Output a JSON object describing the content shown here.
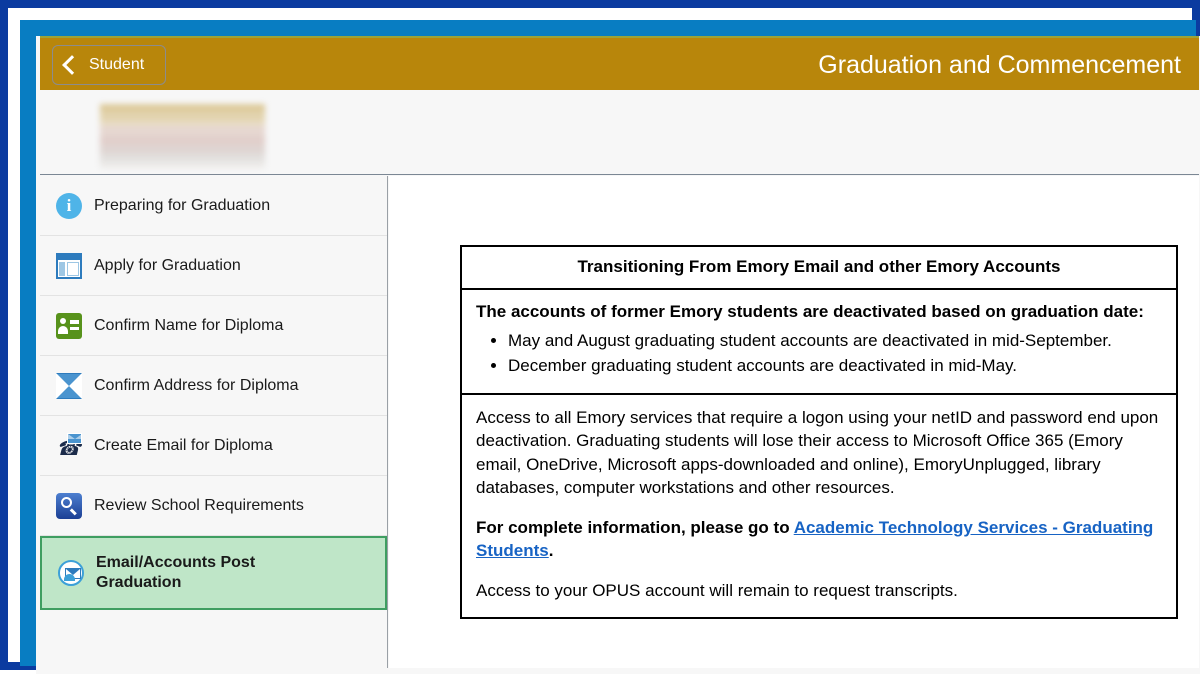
{
  "window": {
    "outer_border_color": "#0b3ba0",
    "inner_border_color": "#087dc2"
  },
  "header": {
    "title": "Graduation and Commencement",
    "back_label": "Student",
    "back_icon": "chevron-left-icon",
    "background_color": "#b8860b"
  },
  "identity": {
    "redacted": true
  },
  "sidebar": {
    "selected_background_color": "#bfe6c8",
    "selected_border_color": "#3f9e61",
    "items": [
      {
        "label": "Preparing for Graduation",
        "icon": "info-circle-icon",
        "selected": false
      },
      {
        "label": "Apply for Graduation",
        "icon": "window-form-icon",
        "selected": false
      },
      {
        "label": "Confirm Name for Diploma",
        "icon": "id-card-icon",
        "selected": false
      },
      {
        "label": "Confirm Address for Diploma",
        "icon": "envelope-icon",
        "selected": false
      },
      {
        "label": "Create Email for Diploma",
        "icon": "phone-mail-icon",
        "selected": false
      },
      {
        "label": "Review School Requirements",
        "icon": "search-icon",
        "selected": false
      },
      {
        "label": "Email/Accounts Post Graduation",
        "icon": "mail-users-icon",
        "selected": true
      }
    ]
  },
  "content": {
    "table_title": "Transitioning From Emory Email and other Emory Accounts",
    "intro_heading": "The accounts of former Emory students are deactivated based on graduation date:",
    "bullets": [
      "May and August graduating student accounts are deactivated in mid-September.",
      "December graduating student accounts are deactivated in mid-May."
    ],
    "paragraph_1": "Access to all Emory services that require a logon using your netID and password end upon deactivation. Graduating students will lose their access to Microsoft Office 365 (Emory email, OneDrive, Microsoft apps-downloaded and online), EmoryUnplugged, library databases, computer workstations and other resources.",
    "paragraph_2_prefix": "For complete information, please go to ",
    "link_text": "Academic Technology Services - Graduating Students",
    "paragraph_2_suffix": ".",
    "paragraph_3": "Access to your OPUS account will remain to request transcripts.",
    "link_color": "#1763c4"
  }
}
